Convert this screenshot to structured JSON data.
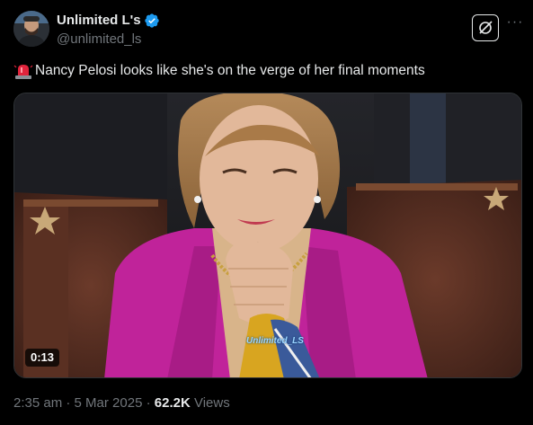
{
  "author": {
    "display_name": "Unlimited L's",
    "handle": "@unlimited_ls",
    "verified": true,
    "avatar_icon": "avatar-photo"
  },
  "header": {
    "grok_icon": "grok-icon",
    "more_icon": "more-options-icon",
    "more_label": "···"
  },
  "tweet": {
    "emoji": "siren-emoji",
    "text": "Nancy Pelosi looks like she's on the verge of her final moments"
  },
  "media": {
    "type": "video",
    "duration": "0:13",
    "watermark": "Unlimited_LS"
  },
  "meta": {
    "time": "2:35 am",
    "separator": " · ",
    "date": "5 Mar 2025",
    "views_count": "62.2K",
    "views_label": " Views"
  },
  "colors": {
    "background": "#000000",
    "text": "#e7e9ea",
    "secondary": "#71767b",
    "verified": "#1d9bf0",
    "jacket": "#c0239a"
  }
}
